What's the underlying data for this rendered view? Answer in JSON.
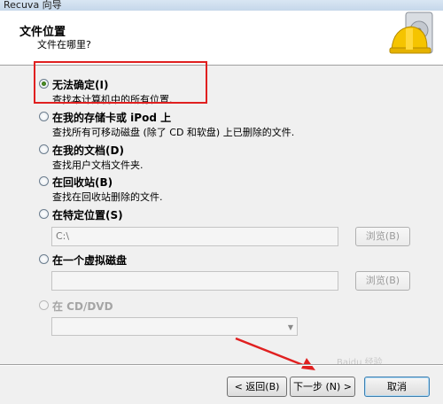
{
  "window": {
    "title": "Recuva 向导"
  },
  "header": {
    "title": "文件位置",
    "subtitle": "文件在哪里?"
  },
  "options": [
    {
      "label": "无法确定(I)",
      "desc": "查找本计算机中的所有位置.",
      "checked": true
    },
    {
      "label": "在我的存储卡或 iPod 上",
      "desc": "查找所有可移动磁盘 (除了 CD 和软盘) 上已删除的文件."
    },
    {
      "label": "在我的文档(D)",
      "desc": "查找用户文档文件夹."
    },
    {
      "label": "在回收站(B)",
      "desc": "查找在回收站删除的文件."
    },
    {
      "label": "在特定位置(S)",
      "path_value": "C:\\",
      "browse_label": "浏览(B)"
    },
    {
      "label": "在一个虚拟磁盘",
      "browse_label": "浏览(B)"
    },
    {
      "label": "在 CD/DVD",
      "disabled": true
    }
  ],
  "buttons": {
    "back": "< 返回(B)",
    "next": "下一步 (N) >",
    "cancel": "取消"
  },
  "watermark": "Baidu 经验",
  "colors": {
    "annotation": "#e02020",
    "accent": "#3c7fb1"
  }
}
